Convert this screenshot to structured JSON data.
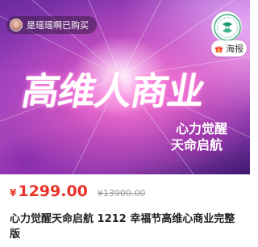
{
  "banner": {
    "buyer_text": "是瑶瑶啊已购买",
    "poster_label": "海报",
    "main_title": "高维人商业",
    "sub_line1": "心力觉醒",
    "sub_line2": "天命启航"
  },
  "price": {
    "currency": "¥",
    "current": "1299.00",
    "original": "¥13900.00"
  },
  "product": {
    "title": "心力觉醒天命启航 1212 幸福节高维心商业完整版"
  },
  "colors": {
    "price_red": "#e8332a",
    "logo_green": "#1f9a6e"
  },
  "icons": [
    "avatar",
    "brand-logo-icon",
    "gift-icon"
  ]
}
